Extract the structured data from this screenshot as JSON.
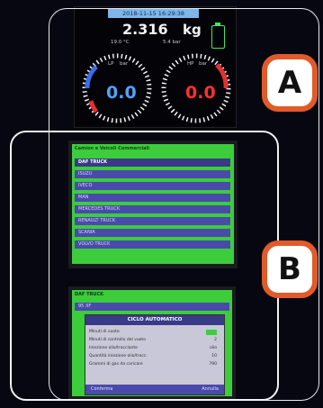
{
  "screen1": {
    "date_time": "2018-11-15 16:29:38",
    "weight_value": "2.316",
    "weight_unit": "kg",
    "temp_label": "19.0 °C",
    "pressure_label": "5.4 bar",
    "gauge_left": {
      "unit_top": "LP",
      "unit_side": "bar",
      "value": "0.0",
      "value_color": "#4fa3ff"
    },
    "gauge_right": {
      "unit_top": "HP",
      "unit_side": "bar",
      "value": "0.0",
      "value_color": "#ff3030"
    },
    "battery_color": "#3ee86a"
  },
  "screen2": {
    "title": "Camion e Veicoli Commerciali",
    "items": [
      "DAF TRUCK",
      "ISUZU",
      "IVECO",
      "MAN",
      "MERCEDES TRUCK",
      "RENAULT TRUCK",
      "SCANIA",
      "VOLVO TRUCK"
    ],
    "selected": "DAF TRUCK"
  },
  "screen3": {
    "title": "DAF TRUCK",
    "bg_item": "95 XF",
    "dialog_title": "CICLO AUTOMATICO",
    "params": [
      {
        "label": "Minuti di vuoto",
        "value": ""
      },
      {
        "label": "Minuti di controllo del vuoto",
        "value": "2"
      },
      {
        "label": "Iniezione olio/tracciante",
        "value": "olio"
      },
      {
        "label": "Quantità iniezione olio/tracc.",
        "value": "10"
      },
      {
        "label": "Grammi di gas da caricare",
        "value": "790"
      }
    ],
    "confirm_label": "Conferma",
    "cancel_label": "Annulla"
  },
  "labels": {
    "a": "A",
    "b": "B"
  },
  "colors": {
    "annotation": "#e25a2a",
    "screen_green": "#3ccc3c",
    "row_blue": "#4a4aaa"
  }
}
